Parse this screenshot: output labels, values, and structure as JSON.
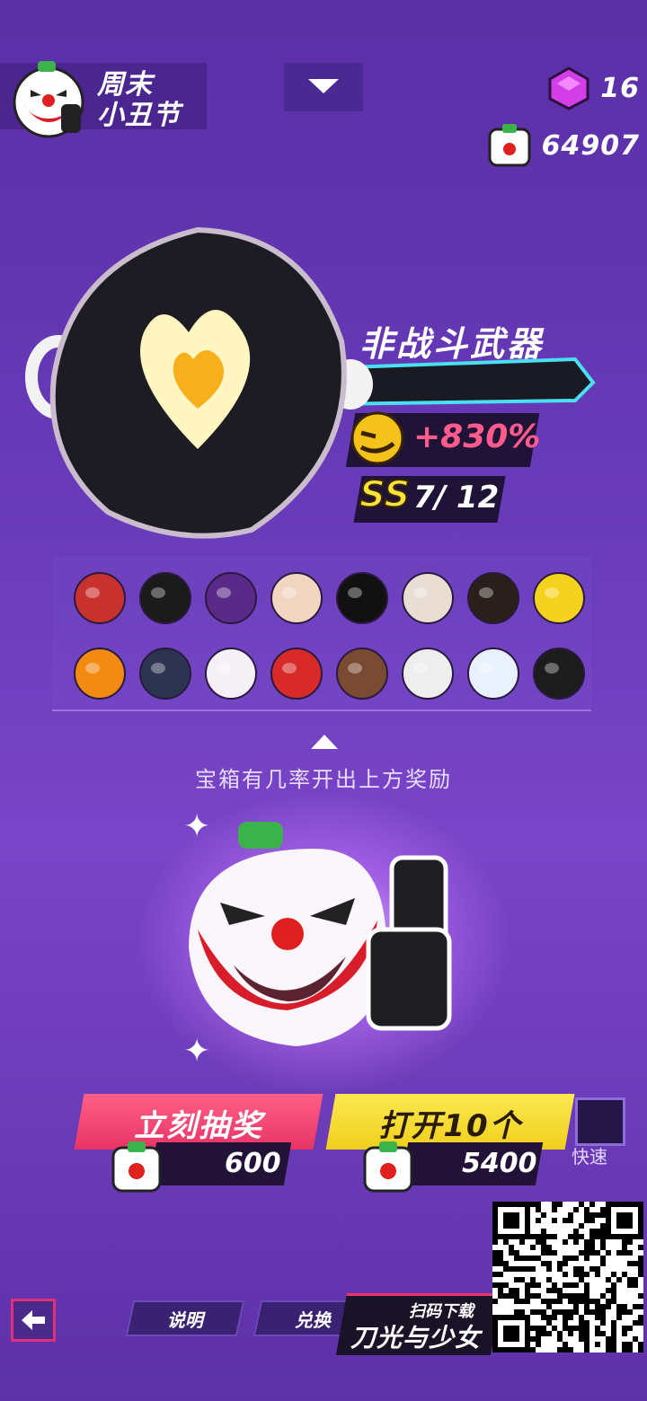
{
  "event": {
    "title_line1": "周末",
    "title_line2": "小丑节",
    "icon": "clown-chest-icon"
  },
  "header": {
    "dropdown_icon": "chevron-down-icon",
    "gems": "16",
    "gem_icon": "purple-gem-icon",
    "tickets": "64907",
    "ticket_icon": "clown-ticket-icon"
  },
  "item": {
    "name": "非战斗武器",
    "bonus": "+830%",
    "rank_label": "SS",
    "rank_progress": "7/ 12",
    "image": "frying-pan-heart-egg"
  },
  "rewards": [
    {
      "name": "nutcracker-hat-icon",
      "color": "#c9312f"
    },
    {
      "name": "black-hair-halo-icon",
      "color": "#1b1b1b"
    },
    {
      "name": "purple-mask-helmet-icon",
      "color": "#5a2a88"
    },
    {
      "name": "blonde-hair-icon",
      "color": "#f2d6c2"
    },
    {
      "name": "black-bunny-red-ears-icon",
      "color": "#111111"
    },
    {
      "name": "goat-skull-icon",
      "color": "#e9ddd4"
    },
    {
      "name": "orange-visor-helmet-icon",
      "color": "#2a1f1a"
    },
    {
      "name": "yellow-block-head-icon",
      "color": "#f4d21e"
    },
    {
      "name": "pumpkin-head-icon",
      "color": "#f38a12"
    },
    {
      "name": "knight-helmet-icon",
      "color": "#2c3450"
    },
    {
      "name": "white-bunny-icon",
      "color": "#f5f1f5"
    },
    {
      "name": "clown-face-icon",
      "color": "#d92a2a"
    },
    {
      "name": "bear-head-icon",
      "color": "#7a4a32"
    },
    {
      "name": "box-head-icon",
      "color": "#eeeeee"
    },
    {
      "name": "white-ghost-icon",
      "color": "#e9f1ff"
    },
    {
      "name": "reaper-hood-icon",
      "color": "#1c1c1c"
    }
  ],
  "hint": "宝箱有几率开出上方奖励",
  "actions": {
    "draw_label": "立刻抽奖",
    "draw_cost": "600",
    "open10_label": "打开10个",
    "open10_cost": "5400",
    "quick_label": "快速"
  },
  "footer": {
    "help_label": "说明",
    "exchange_label": "兑换",
    "download_top": "扫码下载",
    "download_brand": "刀光与少女",
    "back_icon": "back-arrow-icon"
  },
  "colors": {
    "accent_red": "#e83466",
    "accent_yellow": "#f0cf1c",
    "bonus_pink": "#ff5c8d",
    "rank_yellow": "#f7e33a"
  }
}
